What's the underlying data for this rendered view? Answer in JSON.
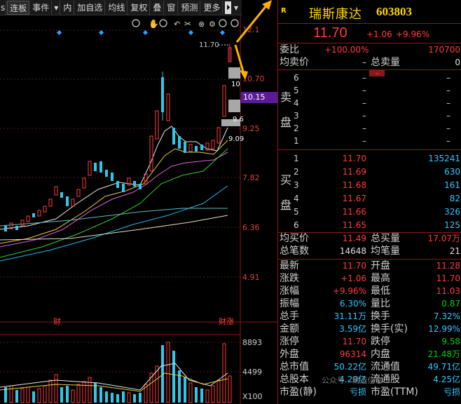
{
  "toolbar": {
    "items": [
      "连板",
      "事件",
      "内",
      "加自选",
      "均线",
      "复权",
      "叠",
      "窗",
      "预测",
      "更多"
    ],
    "left_partial": "s",
    "end_arrow": "⏵",
    "dropdown": "▾"
  },
  "chart": {
    "price_labels": [
      "12.1",
      "11.70",
      "10.70",
      "10.15",
      "9.25",
      "7.82",
      "6.36",
      "4.91"
    ],
    "current_price_tag": "11.70",
    "marker_labels": [
      "10",
      "9.6",
      "9.09"
    ],
    "event_labels": [
      "财",
      "财涨"
    ],
    "volume_labels": [
      "8893",
      "4499"
    ],
    "unit_label": "X100"
  },
  "stock": {
    "badge": "R",
    "name": "瑞斯康达",
    "code": "603803",
    "price": "11.70",
    "change": "+1.06",
    "change_pct": "+9.96%",
    "weibi_label": "委比",
    "weibi_value": "+100.00%",
    "weicha_value": "170700",
    "avg_sell_label": "均卖价",
    "avg_sell_value": "–",
    "total_sell_label": "总卖量",
    "total_sell_value": "0"
  },
  "sell_side": {
    "label1": "卖",
    "label2": "盘",
    "levels": [
      {
        "n": "6",
        "price": "–",
        "vol": "–"
      },
      {
        "n": "5",
        "price": "–",
        "vol": "–"
      },
      {
        "n": "4",
        "price": "–",
        "vol": "–"
      },
      {
        "n": "3",
        "price": "–",
        "vol": "–"
      },
      {
        "n": "2",
        "price": "–",
        "vol": "–"
      },
      {
        "n": "1",
        "price": "–",
        "vol": "–"
      }
    ]
  },
  "buy_side": {
    "label1": "买",
    "label2": "盘",
    "levels": [
      {
        "n": "1",
        "price": "11.70",
        "vol": "135241"
      },
      {
        "n": "2",
        "price": "11.69",
        "vol": "630"
      },
      {
        "n": "3",
        "price": "11.68",
        "vol": "161"
      },
      {
        "n": "4",
        "price": "11.67",
        "vol": "82"
      },
      {
        "n": "5",
        "price": "11.66",
        "vol": "326"
      },
      {
        "n": "6",
        "price": "11.65",
        "vol": "125"
      }
    ]
  },
  "stats": {
    "avg_buy_label": "均买价",
    "avg_buy": "11.49",
    "total_buy_label": "总买量",
    "total_buy": "17.07万",
    "deals_label": "总笔数",
    "deals": "14648",
    "avg_deal_label": "均笔量",
    "avg_deal": "21",
    "rows": [
      {
        "l1": "最新",
        "v1": "11.70",
        "c1": "red",
        "l2": "开盘",
        "v2": "11.28",
        "c2": "red"
      },
      {
        "l1": "涨跌",
        "v1": "+1.06",
        "c1": "red",
        "l2": "最高",
        "v2": "11.70",
        "c2": "red"
      },
      {
        "l1": "涨幅",
        "v1": "+9.96%",
        "c1": "red",
        "l2": "最低",
        "v2": "11.03",
        "c2": "red"
      },
      {
        "l1": "振幅",
        "v1": "6.30%",
        "c1": "cyan",
        "l2": "量比",
        "v2": "0.87",
        "c2": "green"
      },
      {
        "l1": "总手",
        "v1": "31.11万",
        "c1": "cyan",
        "l2": "换手",
        "v2": "7.32%",
        "c2": "cyan"
      },
      {
        "l1": "金额",
        "v1": "3.59亿",
        "c1": "cyan",
        "l2": "换手(实)",
        "v2": "12.99%",
        "c2": "cyan"
      },
      {
        "l1": "涨停",
        "v1": "11.70",
        "c1": "red",
        "l2": "跌停",
        "v2": "9.58",
        "c2": "green"
      },
      {
        "l1": "外盘",
        "v1": "96314",
        "c1": "red",
        "l2": "内盘",
        "v2": "21.48万",
        "c2": "green"
      },
      {
        "l1": "总市值",
        "v1": "50.22亿",
        "c1": "cyan",
        "l2": "流通值",
        "v2": "49.71亿",
        "c2": "cyan"
      },
      {
        "l1": "总股本",
        "v1": "4.29亿",
        "c1": "cyan",
        "l2": "流通股",
        "v2": "4.25亿",
        "c2": "cyan"
      },
      {
        "l1": "市盈(静)",
        "v1": "亏损",
        "c1": "cyan",
        "l2": "市盈(TTM)",
        "v2": "亏损",
        "c2": "cyan"
      }
    ]
  },
  "watermark": "公众号 · 精选信息"
}
